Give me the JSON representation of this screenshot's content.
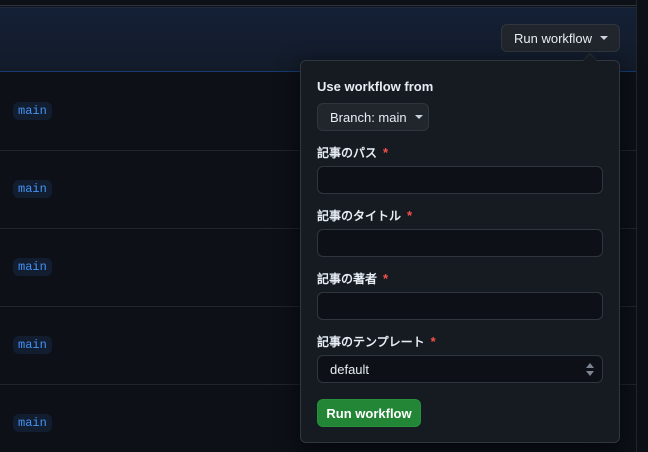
{
  "header": {
    "run_workflow_label": "Run workflow"
  },
  "rows": [
    {
      "branch": "main"
    },
    {
      "branch": "main"
    },
    {
      "branch": "main"
    },
    {
      "branch": "main"
    },
    {
      "branch": "main"
    }
  ],
  "popover": {
    "title": "Use workflow from",
    "branch_select_label": "Branch: main",
    "fields": [
      {
        "label": "記事のパス",
        "required_mark": "*",
        "value": ""
      },
      {
        "label": "記事のタイトル",
        "required_mark": "*",
        "value": ""
      },
      {
        "label": "記事の著者",
        "required_mark": "*",
        "value": ""
      },
      {
        "label": "記事のテンプレート",
        "required_mark": "*",
        "selected": "default"
      }
    ],
    "submit_label": "Run workflow"
  },
  "colors": {
    "background": "#0d1117",
    "branch_tag_text": "#4493f8",
    "required": "#f85149",
    "submit_button": "#238636"
  }
}
